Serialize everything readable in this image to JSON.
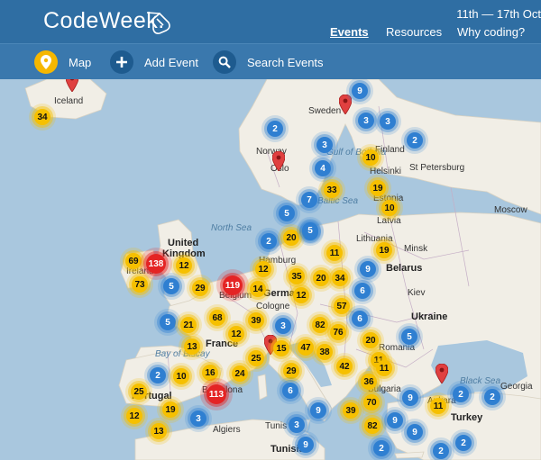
{
  "header": {
    "logo_text": "CodeWeek.",
    "dates": "11th — 17th Oct",
    "nav": [
      "Events",
      "Resources",
      "Why coding?"
    ]
  },
  "toolbar": {
    "map_label": "Map",
    "add_label": "Add Event",
    "search_label": "Search Events"
  },
  "map": {
    "labels": [
      {
        "text": "Iceland",
        "big": false,
        "sea": false
      },
      {
        "text": "Sweden",
        "big": false,
        "sea": false
      },
      {
        "text": "Norway",
        "big": false,
        "sea": false
      },
      {
        "text": "Finland",
        "big": false,
        "sea": false
      },
      {
        "text": "Oslo",
        "big": false,
        "sea": false
      },
      {
        "text": "Helsinki",
        "big": false,
        "sea": false
      },
      {
        "text": "St Petersburg",
        "big": false,
        "sea": false
      },
      {
        "text": "Estonia",
        "big": false,
        "sea": false
      },
      {
        "text": "Latvia",
        "big": false,
        "sea": false
      },
      {
        "text": "Lithuania",
        "big": false,
        "sea": false
      },
      {
        "text": "Minsk",
        "big": false,
        "sea": false
      },
      {
        "text": "Belarus",
        "big": true,
        "sea": false
      },
      {
        "text": "Gulf of Bothnia",
        "big": false,
        "sea": true
      },
      {
        "text": "Baltic Sea",
        "big": false,
        "sea": true
      },
      {
        "text": "North Sea",
        "big": false,
        "sea": true
      },
      {
        "text": "United",
        "big": false,
        "sea": false
      },
      {
        "text": "Kingdom",
        "big": false,
        "sea": false
      },
      {
        "text": "Ireland",
        "big": false,
        "sea": false
      },
      {
        "text": "Hamburg",
        "big": false,
        "sea": false
      },
      {
        "text": "Germany",
        "big": true,
        "sea": false
      },
      {
        "text": "Belgium",
        "big": false,
        "sea": false
      },
      {
        "text": "Cologne",
        "big": false,
        "sea": false
      },
      {
        "text": "Kiev",
        "big": false,
        "sea": false
      },
      {
        "text": "Ukraine",
        "big": true,
        "sea": false
      },
      {
        "text": "France",
        "big": true,
        "sea": false
      },
      {
        "text": "Bay of Biscay",
        "big": false,
        "sea": true
      },
      {
        "text": "Romania",
        "big": false,
        "sea": false
      },
      {
        "text": "Bulgaria",
        "big": false,
        "sea": false
      },
      {
        "text": "Portugal",
        "big": false,
        "sea": false
      },
      {
        "text": "Barcelona",
        "big": false,
        "sea": false
      },
      {
        "text": "Algiers",
        "big": false,
        "sea": false
      },
      {
        "text": "Tunisia",
        "big": false,
        "sea": false
      },
      {
        "text": "Tunis",
        "big": false,
        "sea": false
      },
      {
        "text": "Ankara",
        "big": false,
        "sea": false
      },
      {
        "text": "Turkey",
        "big": true,
        "sea": false
      },
      {
        "text": "Georgia",
        "big": false,
        "sea": false
      },
      {
        "text": "Black Sea",
        "big": false,
        "sea": true
      },
      {
        "text": "Moscow",
        "big": false,
        "sea": false
      }
    ],
    "clusters": [
      {
        "v": "34",
        "c": "yellow"
      },
      {
        "v": "9",
        "c": "blue"
      },
      {
        "v": "3",
        "c": "blue"
      },
      {
        "v": "3",
        "c": "blue"
      },
      {
        "v": "2",
        "c": "blue"
      },
      {
        "v": "3",
        "c": "blue"
      },
      {
        "v": "2",
        "c": "blue"
      },
      {
        "v": "10",
        "c": "yellow"
      },
      {
        "v": "4",
        "c": "blue"
      },
      {
        "v": "33",
        "c": "yellow"
      },
      {
        "v": "19",
        "c": "yellow"
      },
      {
        "v": "7",
        "c": "blue"
      },
      {
        "v": "5",
        "c": "blue"
      },
      {
        "v": "10",
        "c": "yellow"
      },
      {
        "v": "3",
        "c": "blue"
      },
      {
        "v": "2",
        "c": "blue"
      },
      {
        "v": "20",
        "c": "yellow"
      },
      {
        "v": "5",
        "c": "blue"
      },
      {
        "v": "11",
        "c": "yellow"
      },
      {
        "v": "19",
        "c": "yellow"
      },
      {
        "v": "69",
        "c": "yellow"
      },
      {
        "v": "138",
        "c": "red"
      },
      {
        "v": "12",
        "c": "yellow"
      },
      {
        "v": "73",
        "c": "yellow"
      },
      {
        "v": "5",
        "c": "blue"
      },
      {
        "v": "29",
        "c": "yellow"
      },
      {
        "v": "119",
        "c": "red"
      },
      {
        "v": "12",
        "c": "yellow"
      },
      {
        "v": "35",
        "c": "yellow"
      },
      {
        "v": "20",
        "c": "yellow"
      },
      {
        "v": "34",
        "c": "yellow"
      },
      {
        "v": "9",
        "c": "blue"
      },
      {
        "v": "14",
        "c": "yellow"
      },
      {
        "v": "12",
        "c": "yellow"
      },
      {
        "v": "57",
        "c": "yellow"
      },
      {
        "v": "6",
        "c": "blue"
      },
      {
        "v": "5",
        "c": "blue"
      },
      {
        "v": "21",
        "c": "yellow"
      },
      {
        "v": "68",
        "c": "yellow"
      },
      {
        "v": "39",
        "c": "yellow"
      },
      {
        "v": "3",
        "c": "blue"
      },
      {
        "v": "82",
        "c": "yellow"
      },
      {
        "v": "76",
        "c": "yellow"
      },
      {
        "v": "6",
        "c": "blue"
      },
      {
        "v": "12",
        "c": "yellow"
      },
      {
        "v": "13",
        "c": "yellow"
      },
      {
        "v": "15",
        "c": "yellow"
      },
      {
        "v": "47",
        "c": "yellow"
      },
      {
        "v": "20",
        "c": "yellow"
      },
      {
        "v": "5",
        "c": "blue"
      },
      {
        "v": "25",
        "c": "yellow"
      },
      {
        "v": "38",
        "c": "yellow"
      },
      {
        "v": "11",
        "c": "yellow"
      },
      {
        "v": "2",
        "c": "blue"
      },
      {
        "v": "10",
        "c": "yellow"
      },
      {
        "v": "16",
        "c": "yellow"
      },
      {
        "v": "24",
        "c": "yellow"
      },
      {
        "v": "29",
        "c": "yellow"
      },
      {
        "v": "42",
        "c": "yellow"
      },
      {
        "v": "11",
        "c": "yellow"
      },
      {
        "v": "113",
        "c": "red"
      },
      {
        "v": "6",
        "c": "blue"
      },
      {
        "v": "36",
        "c": "yellow"
      },
      {
        "v": "9",
        "c": "blue"
      },
      {
        "v": "25",
        "c": "yellow"
      },
      {
        "v": "19",
        "c": "yellow"
      },
      {
        "v": "3",
        "c": "blue"
      },
      {
        "v": "12",
        "c": "yellow"
      },
      {
        "v": "9",
        "c": "blue"
      },
      {
        "v": "39",
        "c": "yellow"
      },
      {
        "v": "70",
        "c": "yellow"
      },
      {
        "v": "2",
        "c": "blue"
      },
      {
        "v": "2",
        "c": "blue"
      },
      {
        "v": "11",
        "c": "yellow"
      },
      {
        "v": "13",
        "c": "yellow"
      },
      {
        "v": "3",
        "c": "blue"
      },
      {
        "v": "82",
        "c": "yellow"
      },
      {
        "v": "9",
        "c": "blue"
      },
      {
        "v": "2",
        "c": "blue"
      },
      {
        "v": "2",
        "c": "blue"
      },
      {
        "v": "9",
        "c": "blue"
      },
      {
        "v": "9",
        "c": "blue"
      },
      {
        "v": "2",
        "c": "blue"
      }
    ]
  },
  "colors": {
    "header_bg": "#2f6ea3",
    "toolbar_bg": "#3a78ad",
    "sea": "#a9c7de",
    "land": "#f1eee6",
    "cluster_yellow": "#f6c000",
    "cluster_blue": "#2f7fd1",
    "cluster_red": "#e42424"
  },
  "icons": {
    "logo": "mouse-cursor-icon",
    "map": "map-pin-icon",
    "add": "plus-icon",
    "search": "magnifier-icon",
    "event_marker": "map-marker-icon"
  }
}
